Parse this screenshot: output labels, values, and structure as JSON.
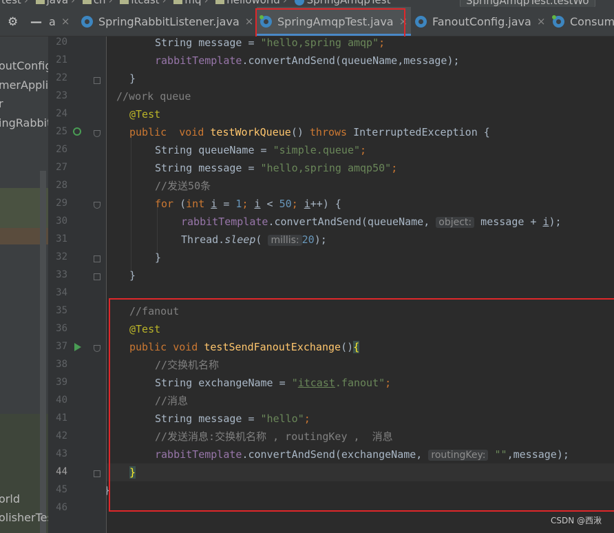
{
  "breadcrumb": {
    "items": [
      "test",
      "java",
      "cn",
      "itcast",
      "mq",
      "helloworld",
      "SpringAmqpTest"
    ],
    "run_config": "SpringAmqpTest.testWo"
  },
  "tabs": {
    "partial_label": "a",
    "items": [
      {
        "label": "SpringRabbitListener.java",
        "active": false
      },
      {
        "label": "SpringAmqpTest.java",
        "active": true
      },
      {
        "label": "FanoutConfig.java",
        "active": false
      },
      {
        "label": "Consume",
        "active": false
      }
    ],
    "close_glyph": "×"
  },
  "project_panel": {
    "items": [
      "outConfig",
      "merApplic",
      "r",
      "ingRabbit",
      "orld",
      "olisherTes"
    ]
  },
  "line_numbers": [
    20,
    21,
    22,
    23,
    24,
    25,
    26,
    27,
    28,
    29,
    30,
    31,
    32,
    33,
    34,
    35,
    36,
    37,
    38,
    39,
    40,
    41,
    42,
    43,
    44,
    45,
    46
  ],
  "current_line": 44,
  "code": {
    "l20_type": "String",
    "l20_var": " message = ",
    "l20_str": "\"hello,spring amqp\"",
    "l20_end": ";",
    "l21_field": "rabbitTemplate",
    "l21_call": ".convertAndSend(queueName,message);",
    "l22_brace": "}",
    "l23_comment": "//work queue",
    "l24_ann": "@Test",
    "l25_kw1": "public",
    "l25_kw2": "void",
    "l25_fn": "testWorkQueue",
    "l25_paren": "() ",
    "l25_throws": "throws",
    "l25_exc": " InterruptedException {",
    "l26_type": "String",
    "l26_var": " queueName = ",
    "l26_str": "\"simple.queue\"",
    "l26_end": ";",
    "l27_type": "String",
    "l27_var": " message = ",
    "l27_str": "\"hello,spring amqp50\"",
    "l27_end": ";",
    "l28_comment": "//发送50条",
    "l29_for": "for",
    "l29_open": " (",
    "l29_int": "int",
    "l29_i1": "i",
    "l29_eq": " = ",
    "l29_n1": "1",
    "l29_semi1": "; ",
    "l29_i2": "i",
    "l29_lt": " < ",
    "l29_n2": "50",
    "l29_semi2": "; ",
    "l29_i3": "i",
    "l29_inc": "++) {",
    "l30_field": "rabbitTemplate",
    "l30_call": ".convertAndSend(queueName, ",
    "l30_hint": "object:",
    "l30_rest1": " message + ",
    "l30_i": "i",
    "l30_rest2": ");",
    "l31_cls": "Thread.",
    "l31_fn": "sleep",
    "l31_open": "( ",
    "l31_hint": "millis:",
    "l31_num": "20",
    "l31_close": ");",
    "l32_brace": "}",
    "l33_brace": "}",
    "l35_comment": "//fanout",
    "l36_ann": "@Test",
    "l37_kw1": "public",
    "l37_kw2": "void",
    "l37_fn": "testSendFanoutExchange",
    "l37_paren": "()",
    "l37_brace": "{",
    "l38_comment": "//交换机名称",
    "l39_type": "String",
    "l39_var": " exchangeName = ",
    "l39_q1": "\"",
    "l39_itcast": "itcast",
    "l39_fanout": ".fanout",
    "l39_q2": "\"",
    "l39_end": ";",
    "l40_comment": "//消息",
    "l41_type": "String",
    "l41_var": " message = ",
    "l41_str": "\"hello\"",
    "l41_end": ";",
    "l42_comment": "//发送消息:交换机名称 , routingKey ,  消息",
    "l43_field": "rabbitTemplate",
    "l43_call": ".convertAndSend(exchangeName, ",
    "l43_hint": "routingKey:",
    "l43_str": " \"\"",
    "l43_rest": ",message);",
    "l44_brace": "}",
    "l45_brace": "}"
  },
  "watermark": "CSDN @西湫",
  "colors": {
    "keyword": "#cc7832",
    "function": "#ffc66d",
    "string": "#6a8759",
    "number": "#6897bb",
    "comment": "#808080",
    "annotation": "#bbb529",
    "field": "#9876aa",
    "highlight_box": "#e0272a"
  }
}
